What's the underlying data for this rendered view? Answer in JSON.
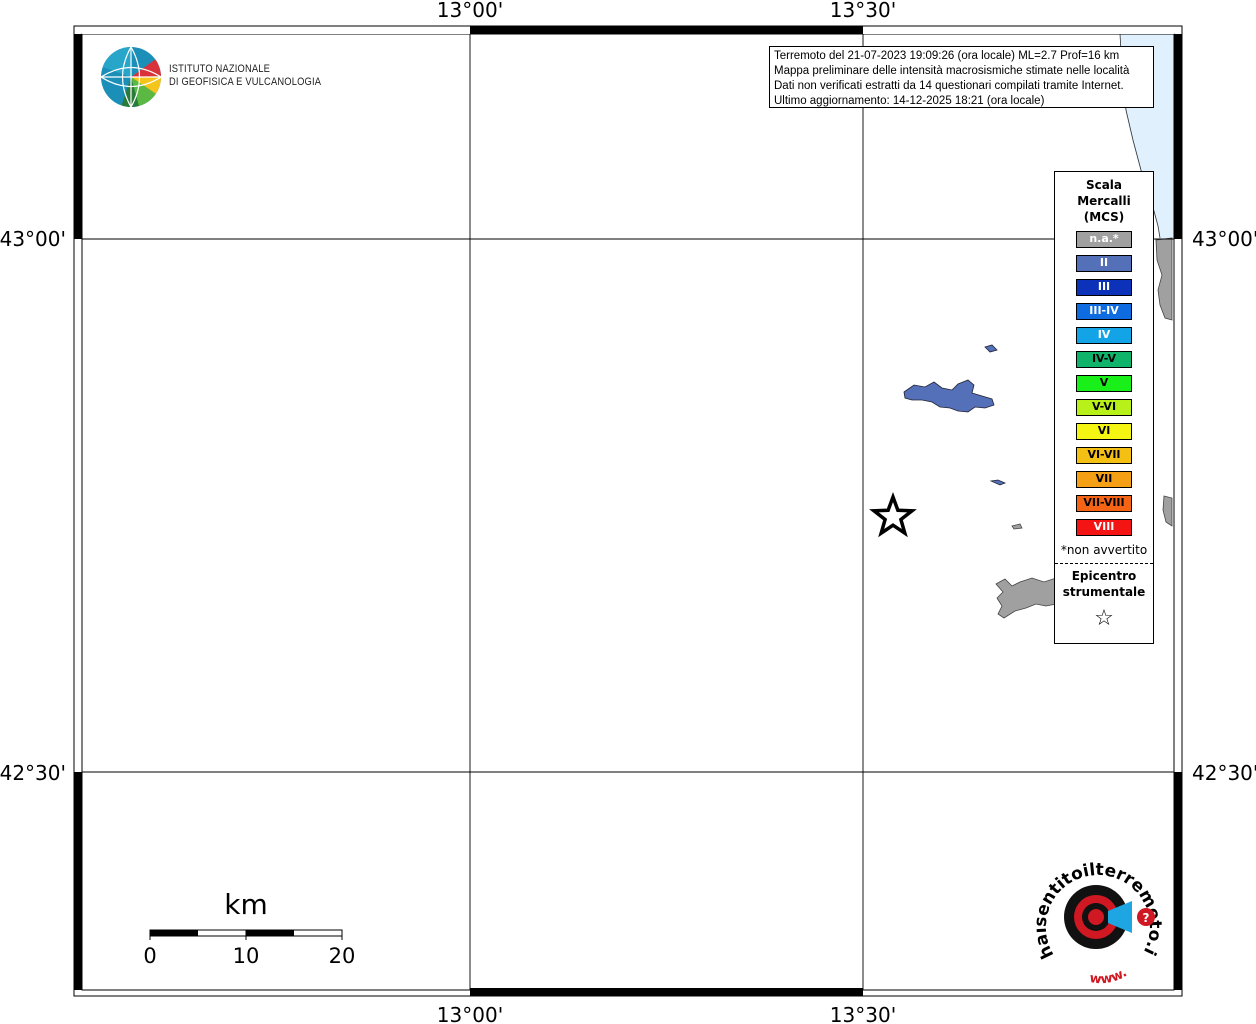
{
  "map": {
    "lon_ticks": [
      "13°00'",
      "13°30'"
    ],
    "lat_ticks": [
      "43°00'",
      "42°30'"
    ],
    "epicentre_icon": "star-outline-icon"
  },
  "info": {
    "line1": "Terremoto del 21-07-2023 19:09:26 (ora locale) ML=2.7 Prof=16 km",
    "line2": "Mappa preliminare delle intensità macrosismiche stimate nelle località",
    "line3": "Dati non verificati estratti da 14 questionari compilati tramite Internet.",
    "line4": "Ultimo aggiornamento: 14-12-2025 18:21 (ora locale)"
  },
  "legend": {
    "title_line1": "Scala",
    "title_line2": "Mercalli",
    "title_line3": "(MCS)",
    "classes": [
      {
        "label": "n.a.*",
        "color": "#a0a0a0",
        "text_color": "#ffffff"
      },
      {
        "label": "II",
        "color": "#5470b8",
        "text_color": "#ffffff"
      },
      {
        "label": "III",
        "color": "#0b32b8",
        "text_color": "#ffffff"
      },
      {
        "label": "III-IV",
        "color": "#0e6be0",
        "text_color": "#ffffff"
      },
      {
        "label": "IV",
        "color": "#12a4e6",
        "text_color": "#ffffff"
      },
      {
        "label": "IV-V",
        "color": "#0fb36a",
        "text_color": "#000000"
      },
      {
        "label": "V",
        "color": "#19f019",
        "text_color": "#000000"
      },
      {
        "label": "V-VI",
        "color": "#b8f01a",
        "text_color": "#000000"
      },
      {
        "label": "VI",
        "color": "#f5f514",
        "text_color": "#000000"
      },
      {
        "label": "VI-VII",
        "color": "#f5c014",
        "text_color": "#000000"
      },
      {
        "label": "VII",
        "color": "#f5a014",
        "text_color": "#000000"
      },
      {
        "label": "VII-VIII",
        "color": "#f56414",
        "text_color": "#000000"
      },
      {
        "label": "VIII",
        "color": "#f51414",
        "text_color": "#ffffff"
      }
    ],
    "na_note": "*non avvertito",
    "epicentre_line1": "Epicentro",
    "epicentre_line2": "strumentale"
  },
  "scalebar": {
    "unit": "km",
    "labels": [
      "0",
      "10",
      "20"
    ]
  },
  "ingv": {
    "line1": "ISTITUTO NAZIONALE",
    "line2": "DI GEOFISICA E VULCANOLOGIA"
  },
  "hsit": {
    "ring_text": "haisentitoilterremoto.it",
    "url_text": "www."
  },
  "colors": {
    "sea": "#e0f0fc",
    "land_na": "#a0a0a0",
    "intensity_II": "#5470b8"
  }
}
